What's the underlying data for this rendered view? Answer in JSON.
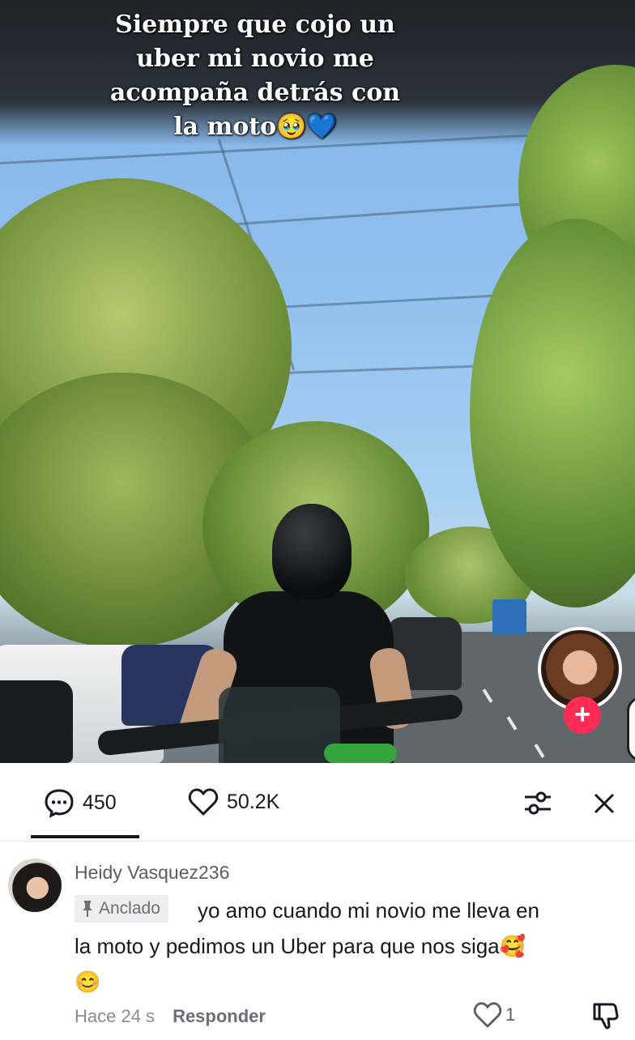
{
  "video": {
    "caption_lines": [
      "Siempre que cojo un",
      "uber mi novio me",
      "acompaña detrás con",
      "la moto🥹💙"
    ],
    "follow_label": "+"
  },
  "tabs": {
    "comments_icon": "comment-bubble-icon",
    "comments_count": "450",
    "likes_icon": "heart-outline-icon",
    "likes_count": "50.2K",
    "filter_icon": "sliders-icon",
    "close_icon": "close-icon"
  },
  "comment": {
    "username": "Heidy Vasquez236",
    "pinned_label": "Anclado",
    "pinned_icon": "pin-icon",
    "text": "yo amo cuando mi novio me lleva en la moto y pedimos un Uber para que nos siga🥰😊",
    "time": "Hace 24 s",
    "reply_label": "Responder",
    "like_count": "1",
    "like_icon": "heart-outline-icon",
    "dislike_icon": "thumbs-down-icon"
  },
  "colors": {
    "accent": "#fe2c55",
    "text_primary": "#161823",
    "text_secondary": "#8a8b91"
  }
}
